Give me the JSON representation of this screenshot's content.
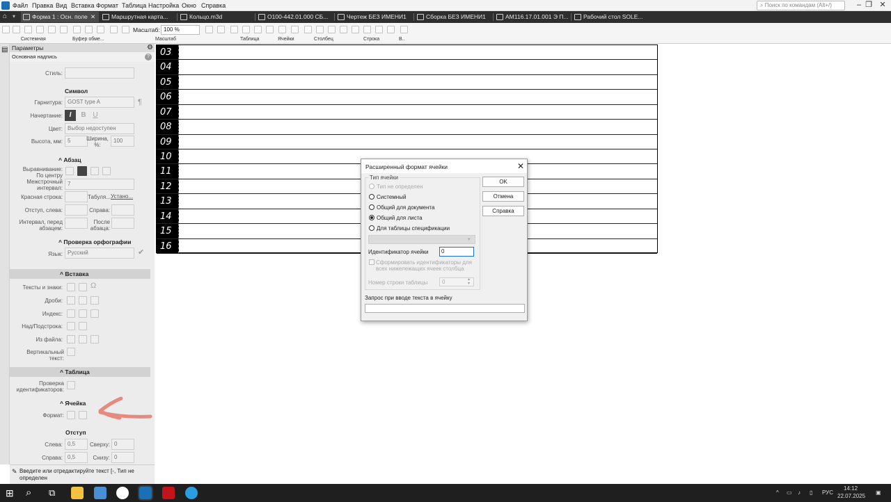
{
  "menubar": {
    "items": [
      "Файл",
      "Правка",
      "Вид",
      "Вставка",
      "Формат",
      "Таблица",
      "Настройка",
      "Окно",
      "Справка"
    ],
    "search_placeholder": "Поиск по командам (Alt+/)"
  },
  "tabs": [
    {
      "label": "Форма 1 : Осн. поле",
      "close": "✕",
      "active": true
    },
    {
      "label": "Маршрутная карта..."
    },
    {
      "label": "Кольцо.m3d"
    },
    {
      "label": "О100-442.01.000 СБ..."
    },
    {
      "label": "Чертеж БЕЗ ИМЕНИ1"
    },
    {
      "label": "Сборка БЕЗ ИМЕНИ1"
    },
    {
      "label": "АМ116.17.01.001 Э П..."
    },
    {
      "label": "Рабочий стол SOLE..."
    }
  ],
  "toolbar": {
    "zoom_label": "Масштаб:",
    "zoom_value": "100 %",
    "groups": [
      "Системная",
      "Буфер обме...",
      "Масштаб",
      "Таблица",
      "Ячейки",
      "Столбец",
      "Строка",
      "В.."
    ]
  },
  "panel": {
    "header": "Параметры",
    "subheader": "Основная надпись",
    "help": "?",
    "style_label": "Стиль:",
    "symbol_title": "Символ",
    "font_label": "Гарнитура:",
    "font_value": "GOST type A",
    "pilcrow": "¶",
    "face_label": "Начертание:",
    "face_italic": "I",
    "face_bold": "B",
    "face_underline": "U",
    "color_label": "Цвет:",
    "color_value": "Выбор недоступен",
    "height_label": "Высота, мм:",
    "height_value": "5",
    "width_label": "Ширина, %:",
    "width_value": "100",
    "paragraph_title": "Абзац",
    "align_label": "Выравнивание:",
    "align_value": "По центру",
    "linespacing_label": "Межстрочный интервал:",
    "linespacing_value": "7",
    "firstline_label": "Красная строка:",
    "tab_label": "Табуля...",
    "tab_value": "Устано...",
    "indent_left_label": "Отступ, слева:",
    "indent_right_label": "Справа:",
    "space_before_label": "Интервал, перед абзацем:",
    "space_after_label": "После абзаца:",
    "spell_title": "Проверка орфографии",
    "lang_label": "Язык:",
    "lang_value": "Русский",
    "insert_title": "Вставка",
    "texts_label": "Тексты и знаки:",
    "omega": "Ω",
    "fractions_label": "Дроби:",
    "index_label": "Индекс:",
    "overunder_label": "Над/Подстрока:",
    "fromfile_label": "Из файла:",
    "vertical_label": "Вертикальный текст:",
    "table_title": "Таблица",
    "idcheck_label": "Проверка идентификаторов:",
    "cell_title": "Ячейка",
    "format_label": "Формат:",
    "margin_title": "Отступ",
    "m_left_label": "Слева:",
    "m_left_value": "0,5",
    "m_top_label": "Сверху:",
    "m_top_value": "0",
    "m_right_label": "Справа:",
    "m_right_value": "0,5",
    "m_bottom_label": "Снизу:",
    "m_bottom_value": "0"
  },
  "status_text": "Введите или отредактируйте текст [-, Тип не определен",
  "table_rows": [
    "03",
    "04",
    "05",
    "06",
    "07",
    "08",
    "09",
    "10",
    "11",
    "12",
    "13",
    "14",
    "15",
    "16"
  ],
  "dialog": {
    "title": "Расширенный формат ячейки",
    "close": "✕",
    "group_title": "Тип ячейки",
    "options": [
      {
        "label": "Тип не определен",
        "disabled": true,
        "selected": false
      },
      {
        "label": "Системный",
        "disabled": false,
        "selected": false
      },
      {
        "label": "Общий для документа",
        "disabled": false,
        "selected": false
      },
      {
        "label": "Общий для листа",
        "disabled": false,
        "selected": true
      },
      {
        "label": "Для таблицы спецификации",
        "disabled": false,
        "selected": false
      }
    ],
    "id_label": "Идентификатор ячейки",
    "id_value": "0",
    "gen_ids_label": "Сформировать идентификаторы для всех нижележащих ячеек столбца",
    "rownum_label": "Номер строки таблицы",
    "rownum_value": "0",
    "query_label": "Запрос при вводе текста в ячейку",
    "ok": "OK",
    "cancel": "Отмена",
    "help": "Справка"
  },
  "taskbar": {
    "lang": "РУС",
    "time": "14:12",
    "date": "22.07.2025"
  }
}
